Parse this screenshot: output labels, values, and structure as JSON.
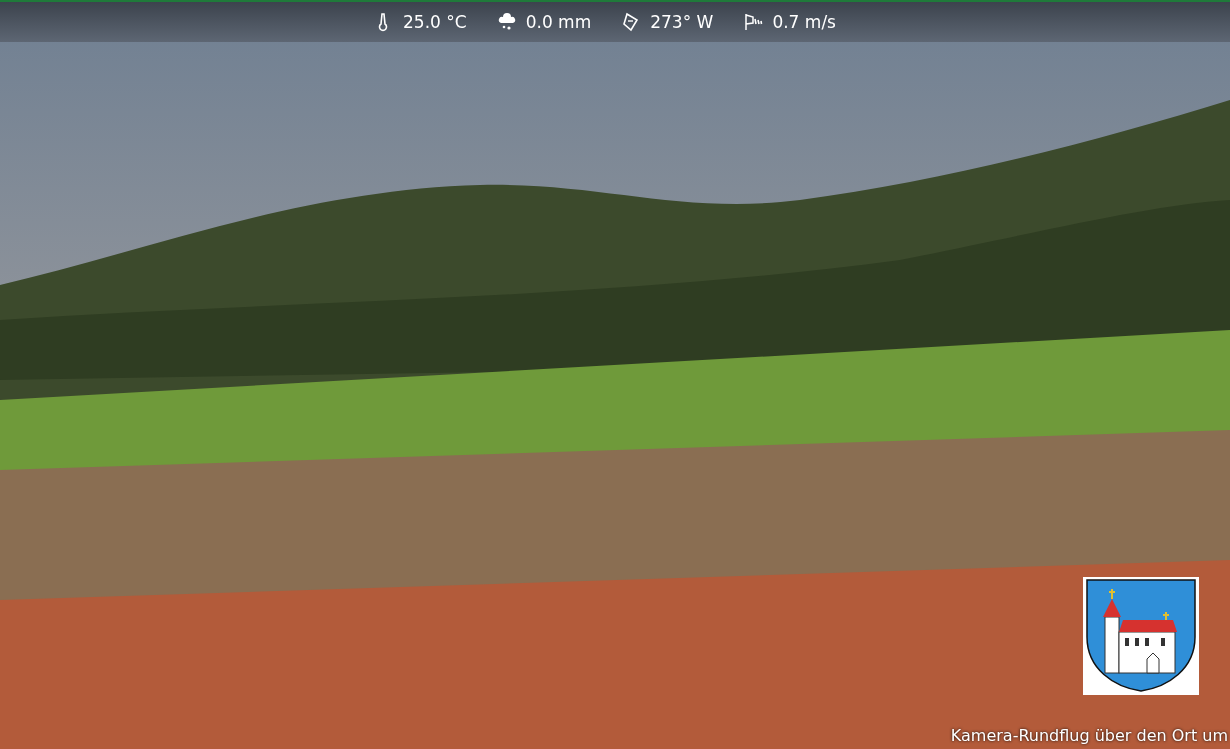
{
  "weather": [
    {
      "kind": "temperature",
      "value": "25.0 °C"
    },
    {
      "kind": "rain",
      "value": "0.0 mm"
    },
    {
      "kind": "direction",
      "value": "273° W"
    },
    {
      "kind": "wind",
      "value": "0.7 m/s"
    }
  ],
  "caption": "Kamera-Rundflug über den Ort um"
}
